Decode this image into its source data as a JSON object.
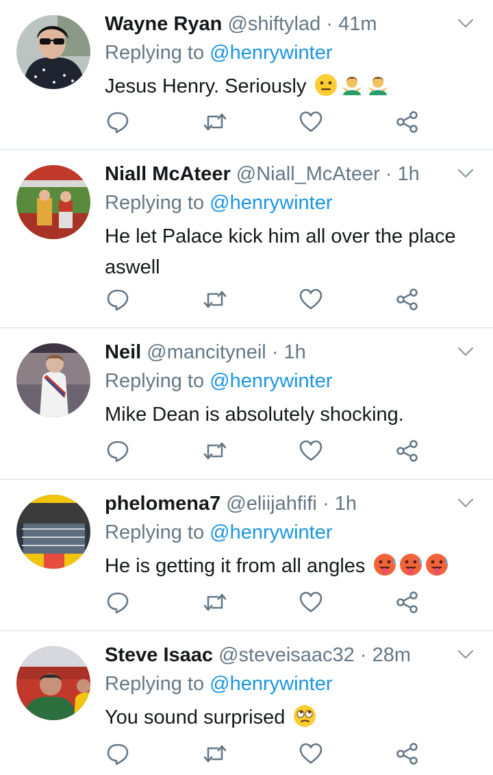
{
  "replying_label": "Replying to",
  "tweets": [
    {
      "name": "Wayne Ryan",
      "handle": "@shiftylad",
      "separator": "·",
      "time": "41m",
      "reply_to": "@henrywinter",
      "text": "Jesus Henry. Seriously",
      "emojis": [
        "neutral-face-emoji",
        "person-shrugging-emoji",
        "person-shrugging-emoji"
      ]
    },
    {
      "name": "Niall McAteer",
      "handle": "@Niall_McAteer",
      "separator": "·",
      "time": "1h",
      "reply_to": "@henrywinter",
      "text": "He let Palace kick him all over the place aswell",
      "emojis": []
    },
    {
      "name": "Neil",
      "handle": "@mancityneil",
      "separator": "·",
      "time": "1h",
      "reply_to": "@henrywinter",
      "text": "Mike Dean is absolutely shocking.",
      "emojis": []
    },
    {
      "name": "phelomena7",
      "handle": "@eliijahfifi",
      "separator": "·",
      "time": "1h",
      "reply_to": "@henrywinter",
      "text": "He is getting it from all angles",
      "emojis": [
        "hot-face-emoji",
        "hot-face-emoji",
        "hot-face-emoji"
      ]
    },
    {
      "name": "Steve Isaac",
      "handle": "@steveisaac32",
      "separator": "·",
      "time": "28m",
      "reply_to": "@henrywinter",
      "text": "You sound surprised",
      "emojis": [
        "eye-roll-emoji"
      ]
    }
  ],
  "icons": {
    "reply": "reply-icon",
    "retweet": "retweet-icon",
    "like": "heart-icon",
    "share": "share-icon",
    "menu": "chevron-down-icon"
  },
  "colors": {
    "name": "#14171a",
    "secondary": "#657786",
    "mention": "#1b95e0",
    "divider": "#d6dde3"
  }
}
